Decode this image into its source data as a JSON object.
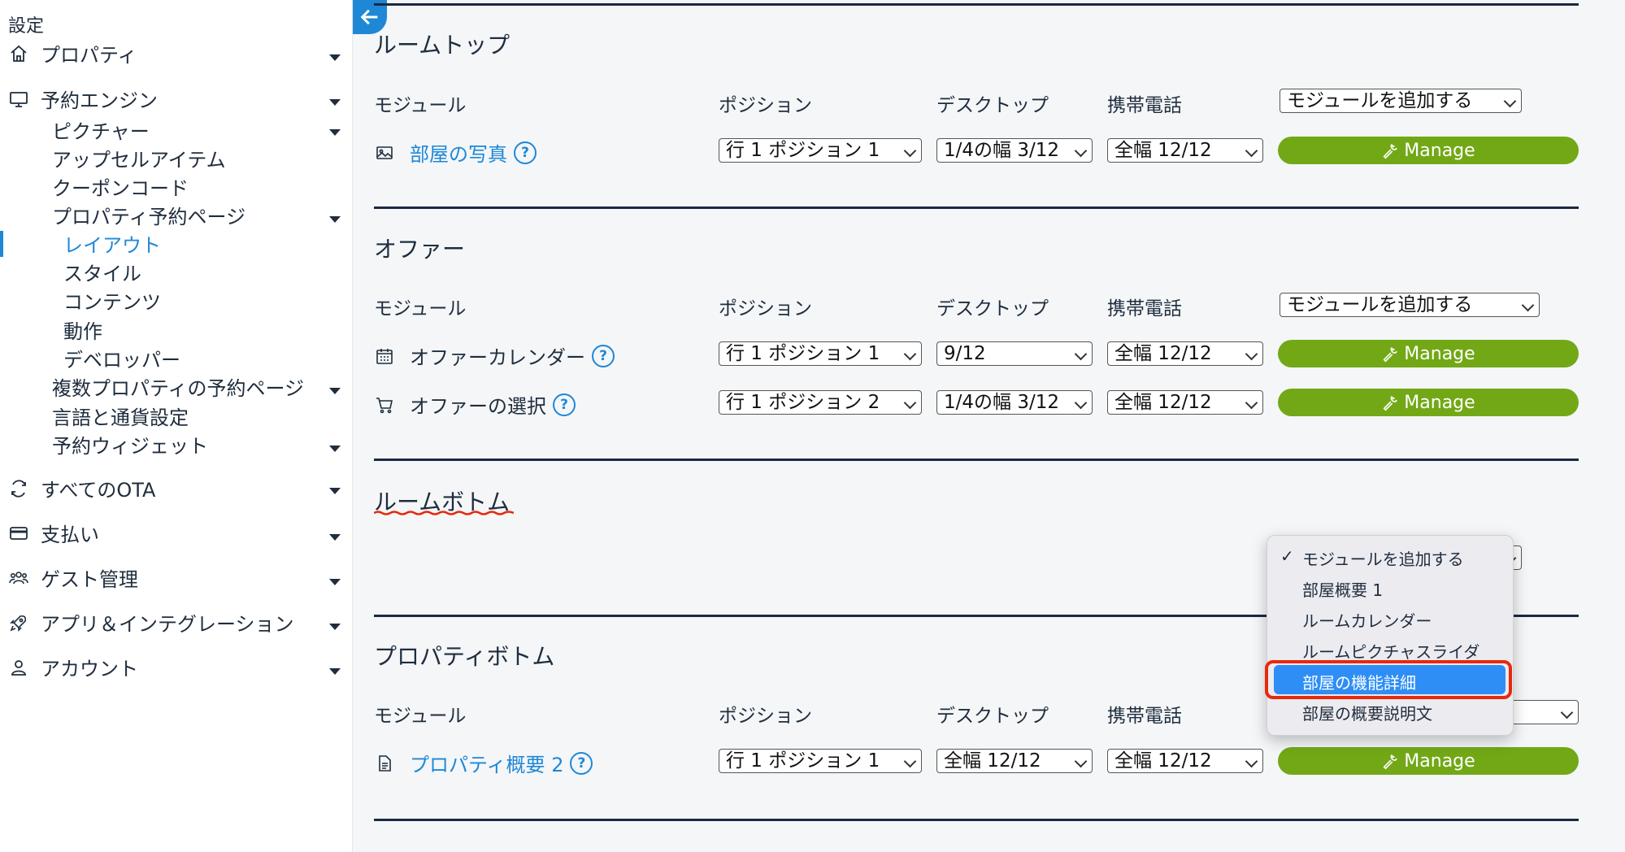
{
  "sidebar": {
    "heading": "設定",
    "items": [
      {
        "label": "プロパティ",
        "icon": "home-icon"
      },
      {
        "label": "予約エンジン",
        "icon": "monitor-icon"
      },
      {
        "label": "ピクチャー"
      },
      {
        "label": "アップセルアイテム"
      },
      {
        "label": "クーポンコード"
      },
      {
        "label": "プロパティ予約ページ"
      },
      {
        "label": "レイアウト",
        "active": true
      },
      {
        "label": "スタイル"
      },
      {
        "label": "コンテンツ"
      },
      {
        "label": "動作"
      },
      {
        "label": "デベロッパー"
      },
      {
        "label": "複数プロパティの予約ページ"
      },
      {
        "label": "言語と通貨設定"
      },
      {
        "label": "予約ウィジェット"
      },
      {
        "label": "すべてのOTA",
        "icon": "sync-icon"
      },
      {
        "label": "支払い",
        "icon": "credit-card-icon"
      },
      {
        "label": "ゲスト管理",
        "icon": "users-icon"
      },
      {
        "label": "アプリ＆インテグレーション",
        "icon": "rocket-icon"
      },
      {
        "label": "アカウント",
        "icon": "user-icon"
      }
    ]
  },
  "columns": {
    "module": "モジュール",
    "position": "ポジション",
    "desktop": "デスクトップ",
    "mobile": "携帯電話"
  },
  "add_module_label": "モジュールを追加する",
  "manage_label": "Manage",
  "sections": {
    "room_top": {
      "title": "ルームトップ",
      "rows": [
        {
          "name": "部屋の写真",
          "icon": "image-icon",
          "position": "行 1 ポジション 1",
          "desktop": "1/4の幅 3/12",
          "mobile": "全幅 12/12"
        }
      ]
    },
    "offer": {
      "title": "オファー",
      "rows": [
        {
          "name": "オファーカレンダー",
          "icon": "calendar-icon",
          "position": "行 1 ポジション 1",
          "desktop": "9/12",
          "mobile": "全幅 12/12"
        },
        {
          "name": "オファーの選択",
          "icon": "cart-icon",
          "position": "行 1 ポジション 2",
          "desktop": "1/4の幅 3/12",
          "mobile": "全幅 12/12"
        }
      ]
    },
    "room_bottom": {
      "title": "ルームボトム"
    },
    "property_bottom": {
      "title": "プロパティボトム",
      "rows": [
        {
          "name": "プロパティ概要 2",
          "icon": "document-icon",
          "position": "行 1 ポジション 1",
          "desktop": "全幅 12/12",
          "mobile": "全幅 12/12"
        }
      ]
    }
  },
  "dropdown": {
    "selected_check": "✓",
    "options": [
      "モジュールを追加する",
      "部屋概要 1",
      "ルームカレンダー",
      "ルームピクチャスライダ",
      "部屋の機能詳細",
      "部屋の概要説明文"
    ],
    "highlighted": "部屋の機能詳細"
  },
  "help_glyph": "?",
  "colors": {
    "accent": "#1e88d7",
    "manage": "#72a816",
    "highlight": "#2e8ef5",
    "annotation": "#e8290b"
  }
}
